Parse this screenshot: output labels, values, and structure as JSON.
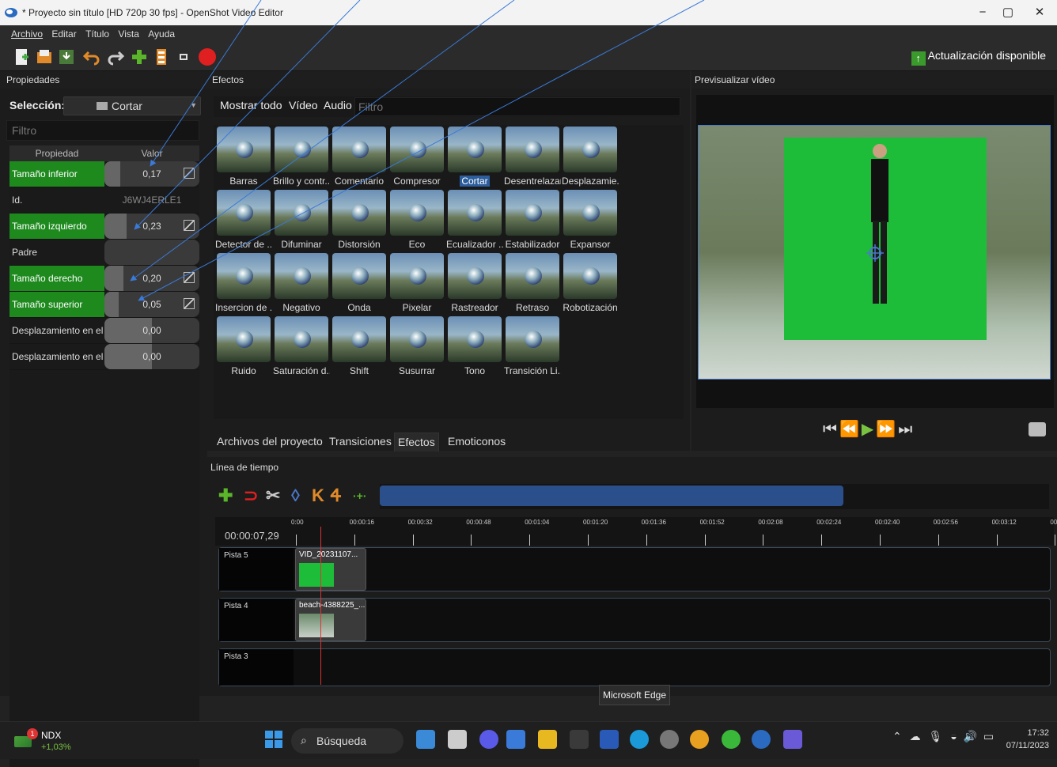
{
  "window": {
    "title": "* Proyecto sin título [HD 720p 30 fps] - OpenShot Video Editor"
  },
  "menu": [
    "Archivo",
    "Editar",
    "Título",
    "Vista",
    "Ayuda"
  ],
  "toolbar": {
    "update_label": "Actualización disponible"
  },
  "properties": {
    "title": "Propiedades",
    "selection_label": "Selección:",
    "selection_value": "Cortar",
    "filter_placeholder": "Filtro",
    "header_property": "Propiedad",
    "header_value": "Valor",
    "rows": [
      {
        "name": "Tamaño inferior",
        "value": "0,17",
        "fill": 0.17,
        "keyframe": true,
        "highlight": true
      },
      {
        "name": "Id.",
        "value": "J6WJ4ERLE1",
        "fill": 0,
        "keyframe": false,
        "highlight": false
      },
      {
        "name": "Tamaño izquierdo",
        "value": "0,23",
        "fill": 0.23,
        "keyframe": true,
        "highlight": true
      },
      {
        "name": "Padre",
        "value": "",
        "fill": 0,
        "keyframe": false,
        "highlight": false
      },
      {
        "name": "Tamaño derecho",
        "value": "0,20",
        "fill": 0.2,
        "keyframe": true,
        "highlight": true
      },
      {
        "name": "Tamaño superior",
        "value": "0,05",
        "fill": 0.05,
        "keyframe": true,
        "highlight": true
      },
      {
        "name": "Desplazamiento en el ...",
        "value": "0,00",
        "fill": 0.5,
        "keyframe": false,
        "highlight": false
      },
      {
        "name": "Desplazamiento en el ...",
        "value": "0,00",
        "fill": 0.5,
        "keyframe": false,
        "highlight": false
      }
    ]
  },
  "effects": {
    "title": "Efectos",
    "tabs": [
      "Mostrar todo",
      "Vídeo",
      "Audio"
    ],
    "filter_placeholder": "Filtro",
    "items": [
      "Barras",
      "Brillo y contr...",
      "Comentario",
      "Compresor",
      "Cortar",
      "Desentrelazar",
      "Desplazamie...",
      "Detector de ...",
      "Difuminar",
      "Distorsión",
      "Eco",
      "Ecualizador ...",
      "Estabilizador",
      "Expansor",
      "Insercion de ...",
      "Negativo",
      "Onda",
      "Pixelar",
      "Rastreador",
      "Retraso",
      "Robotización",
      "Ruido",
      "Saturación d...",
      "Shift",
      "Susurrar",
      "Tono",
      "Transición Li..."
    ],
    "selected": "Cortar"
  },
  "bottom_tabs": [
    "Archivos del proyecto",
    "Transiciones",
    "Efectos",
    "Emoticonos"
  ],
  "preview": {
    "title": "Previsualizar vídeo"
  },
  "timeline": {
    "title": "Línea de tiempo",
    "timecode": "00:00:07,29",
    "ruler": [
      "0:00",
      "00:00:16",
      "00:00:32",
      "00:00:48",
      "00:01:04",
      "00:01:20",
      "00:01:36",
      "00:01:52",
      "00:02:08",
      "00:02:24",
      "00:02:40",
      "00:02:56",
      "00:03:12",
      "00:0"
    ],
    "tracks": [
      {
        "name": "Pista 5",
        "clip": "VID_20231107..."
      },
      {
        "name": "Pista 4",
        "clip": "beach-4388225_..."
      },
      {
        "name": "Pista 3",
        "clip": ""
      }
    ]
  },
  "tooltip": "Microsoft Edge",
  "taskbar": {
    "stock_name": "NDX",
    "stock_change": "+1,03%",
    "stock_badge": "1",
    "search_label": "Búsqueda",
    "time": "17:32",
    "date": "07/11/2023"
  },
  "colors": {
    "accent_green": "#1e8a1e",
    "selection_blue": "#2c5d9c",
    "play_green": "#7ac142",
    "playhead_red": "#dd3333"
  }
}
